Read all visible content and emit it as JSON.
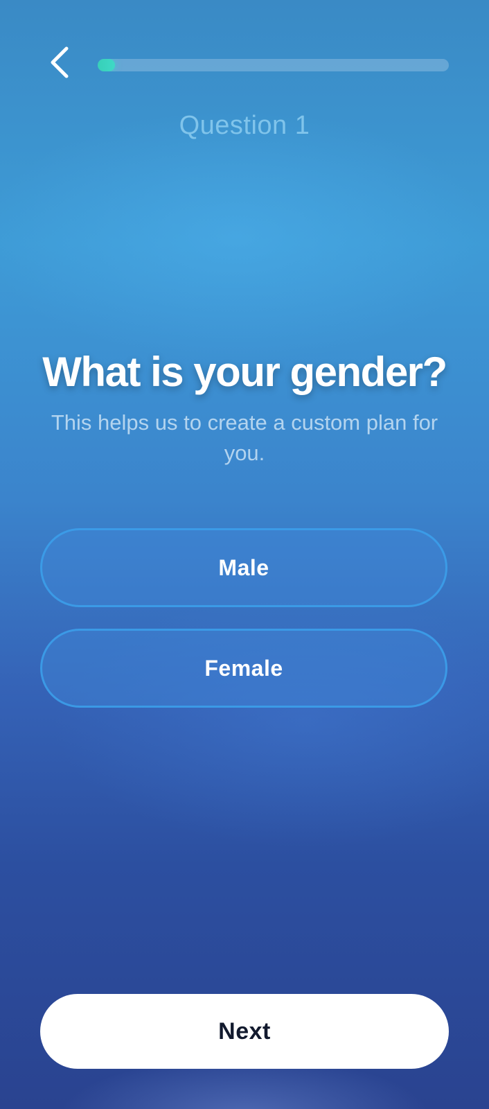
{
  "header": {
    "back_icon": "chevron-left-icon",
    "progress_fraction": 0.05,
    "progress_color": "#3fd9c6"
  },
  "question": {
    "counter": "Question 1",
    "title": "What is your gender?",
    "subtitle": "This helps us to create a custom plan for you."
  },
  "options": [
    {
      "label": "Male"
    },
    {
      "label": "Female"
    }
  ],
  "footer": {
    "next_label": "Next"
  },
  "colors": {
    "accent": "#3fd9c6",
    "option_border": "#3ca0eb",
    "background_top": "#3a8ac5",
    "background_bottom": "#2a4390"
  }
}
